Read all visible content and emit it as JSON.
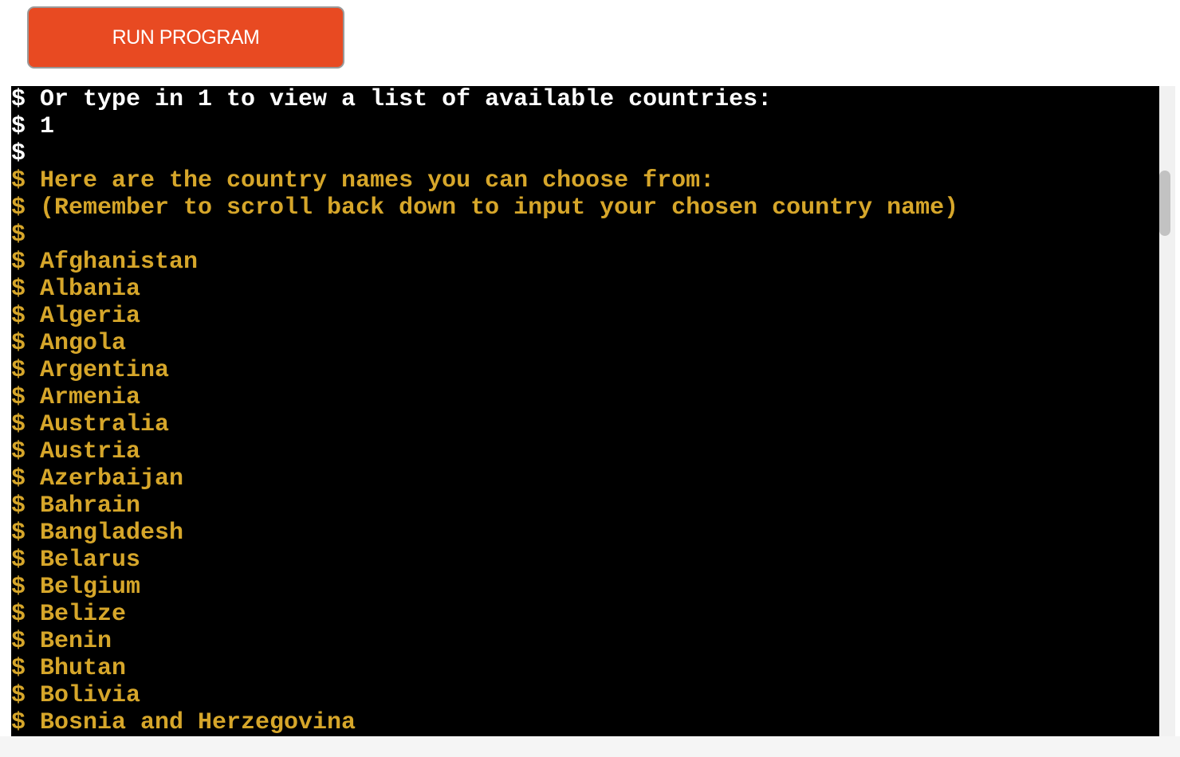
{
  "toolbar": {
    "run_label": "RUN PROGRAM",
    "run_color": "#e84a22"
  },
  "terminal": {
    "prompt_symbol": "$",
    "colors": {
      "background": "#000000",
      "normal_text": "#ffffff",
      "highlight_text": "#d6a62a"
    },
    "lines": [
      {
        "text": "Or type in 1 to view a list of available countries:",
        "color": "white"
      },
      {
        "text": "1",
        "color": "white"
      },
      {
        "text": "",
        "color": "white"
      },
      {
        "text": "Here are the country names you can choose from:",
        "color": "yellow"
      },
      {
        "text": "(Remember to scroll back down to input your chosen country name)",
        "color": "yellow"
      },
      {
        "text": "",
        "color": "yellow"
      },
      {
        "text": "Afghanistan",
        "color": "yellow"
      },
      {
        "text": "Albania",
        "color": "yellow"
      },
      {
        "text": "Algeria",
        "color": "yellow"
      },
      {
        "text": "Angola",
        "color": "yellow"
      },
      {
        "text": "Argentina",
        "color": "yellow"
      },
      {
        "text": "Armenia",
        "color": "yellow"
      },
      {
        "text": "Australia",
        "color": "yellow"
      },
      {
        "text": "Austria",
        "color": "yellow"
      },
      {
        "text": "Azerbaijan",
        "color": "yellow"
      },
      {
        "text": "Bahrain",
        "color": "yellow"
      },
      {
        "text": "Bangladesh",
        "color": "yellow"
      },
      {
        "text": "Belarus",
        "color": "yellow"
      },
      {
        "text": "Belgium",
        "color": "yellow"
      },
      {
        "text": "Belize",
        "color": "yellow"
      },
      {
        "text": "Benin",
        "color": "yellow"
      },
      {
        "text": "Bhutan",
        "color": "yellow"
      },
      {
        "text": "Bolivia",
        "color": "yellow"
      },
      {
        "text": "Bosnia and Herzegovina",
        "color": "yellow"
      }
    ]
  }
}
